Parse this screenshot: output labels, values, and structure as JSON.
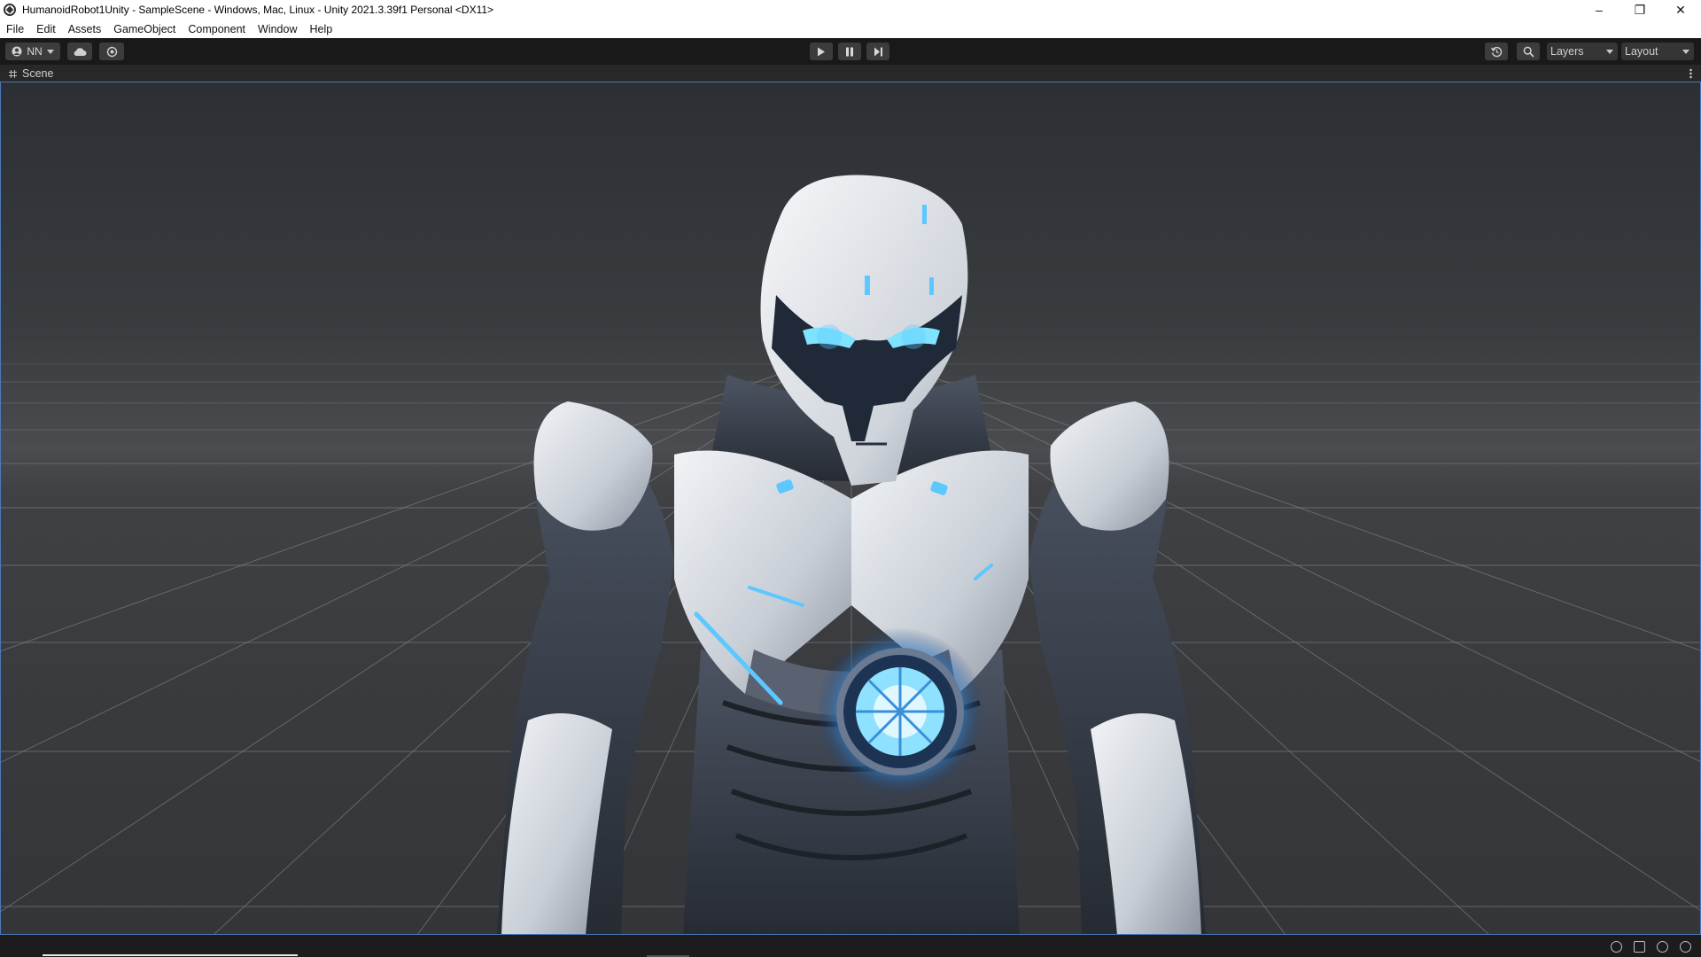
{
  "window": {
    "title": "HumanoidRobot1Unity - SampleScene - Windows, Mac, Linux - Unity 2021.3.39f1 Personal <DX11>",
    "minimize_glyph": "–",
    "restore_glyph": "❐",
    "close_glyph": "✕"
  },
  "menu": [
    "File",
    "Edit",
    "Assets",
    "GameObject",
    "Component",
    "Window",
    "Help"
  ],
  "toolbar": {
    "account_label": "NN",
    "layers_label": "Layers",
    "layout_label": "Layout",
    "play_glyph": "▶",
    "pause_glyph": "❚❚",
    "step_glyph": "▶|"
  },
  "scene": {
    "tab_label": "Scene"
  },
  "colors": {
    "accent": "#4d78b8",
    "glow": "#5cc8ff",
    "armor_light": "#d6dbe2",
    "armor_dark": "#3b4250"
  },
  "icons": [
    "unity-logo-icon",
    "account-icon",
    "cloud-icon",
    "collab-icon",
    "play-icon",
    "pause-icon",
    "step-icon",
    "history-icon",
    "search-icon",
    "grid-icon",
    "kebab-menu-icon",
    "bug-icon",
    "database-icon",
    "network-icon",
    "check-circle-icon"
  ]
}
